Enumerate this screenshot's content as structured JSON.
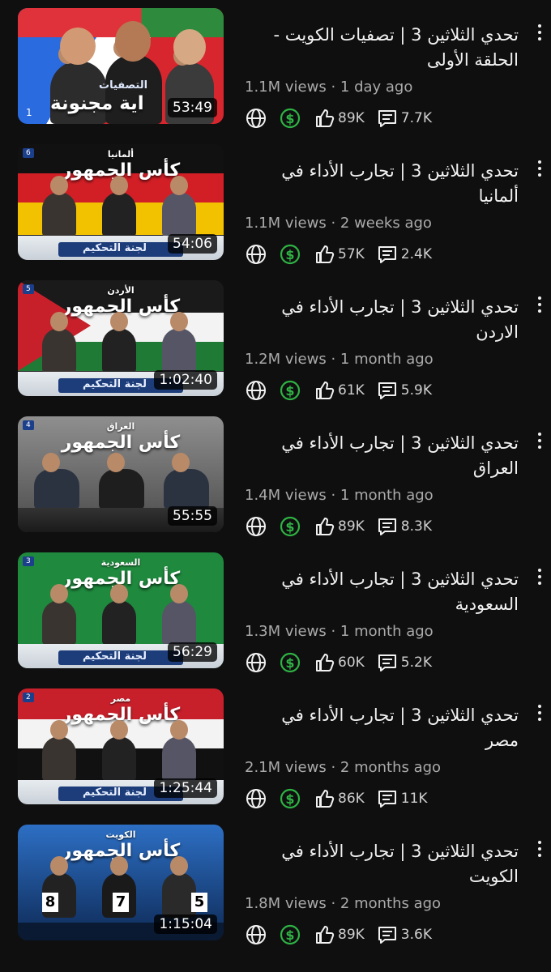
{
  "videos": [
    {
      "title": "تحدي الثلاثين 3 | تصفيات الكويت - الحلقة الأولى",
      "views": "1.1M views",
      "age": "1 day ago",
      "likes": "89K",
      "comments": "7.7K",
      "duration": "53:49",
      "thumb_text": "اية مجنونة",
      "thumb_label": "التصفيات",
      "thumb_episode": "1"
    },
    {
      "title": "تحدي الثلاثين 3 | تجارب الأداء في ألمانيا",
      "views": "1.1M views",
      "age": "2 weeks ago",
      "likes": "57K",
      "comments": "2.4K",
      "duration": "54:06",
      "thumb_country": "ألمانيا",
      "thumb_title": "كأس الجمهور",
      "thumb_panel": "لجنة التحكيم",
      "thumb_episode": "6"
    },
    {
      "title": "تحدي الثلاثين 3 | تجارب الأداء في الاردن",
      "views": "1.2M views",
      "age": "1 month ago",
      "likes": "61K",
      "comments": "5.9K",
      "duration": "1:02:40",
      "thumb_country": "الأردن",
      "thumb_title": "كأس الجمهور",
      "thumb_panel": "لجنة التحكيم",
      "thumb_episode": "5"
    },
    {
      "title": "تحدي الثلاثين 3 | تجارب الأداء في العراق",
      "views": "1.4M views",
      "age": "1 month ago",
      "likes": "89K",
      "comments": "8.3K",
      "duration": "55:55",
      "thumb_country": "العراق",
      "thumb_title": "كأس الجمهور",
      "thumb_episode": "4"
    },
    {
      "title": "تحدي الثلاثين 3 | تجارب الأداء في السعودية",
      "views": "1.3M views",
      "age": "1 month ago",
      "likes": "60K",
      "comments": "5.2K",
      "duration": "56:29",
      "thumb_country": "السعودية",
      "thumb_title": "كأس الجمهور",
      "thumb_panel": "لجنة التحكيم",
      "thumb_episode": "3"
    },
    {
      "title": "تحدي الثلاثين 3 | تجارب الأداء في مصر",
      "views": "2.1M views",
      "age": "2 months ago",
      "likes": "86K",
      "comments": "11K",
      "duration": "1:25:44",
      "thumb_country": "مصر",
      "thumb_title": "كأس الجمهور",
      "thumb_panel": "لجنة التحكيم",
      "thumb_episode": "2"
    },
    {
      "title": "تحدي الثلاثين 3 | تجارب الأداء في الكويت",
      "views": "1.8M views",
      "age": "2 months ago",
      "likes": "89K",
      "comments": "3.6K",
      "duration": "1:15:04",
      "thumb_country": "الكويت",
      "thumb_title": "كأس الجمهور",
      "thumb_scores": [
        "8",
        "7",
        "5"
      ]
    }
  ],
  "icons": {
    "language": "globe-icon",
    "monetized": "dollar-icon",
    "likes": "thumbs-up-icon",
    "comments": "comment-icon",
    "menu": "more-vertical-icon"
  },
  "colors": {
    "background": "#0f0f0f",
    "title": "#f1f1f1",
    "meta": "#aaaaaa",
    "monetized_green": "#2fb344"
  }
}
